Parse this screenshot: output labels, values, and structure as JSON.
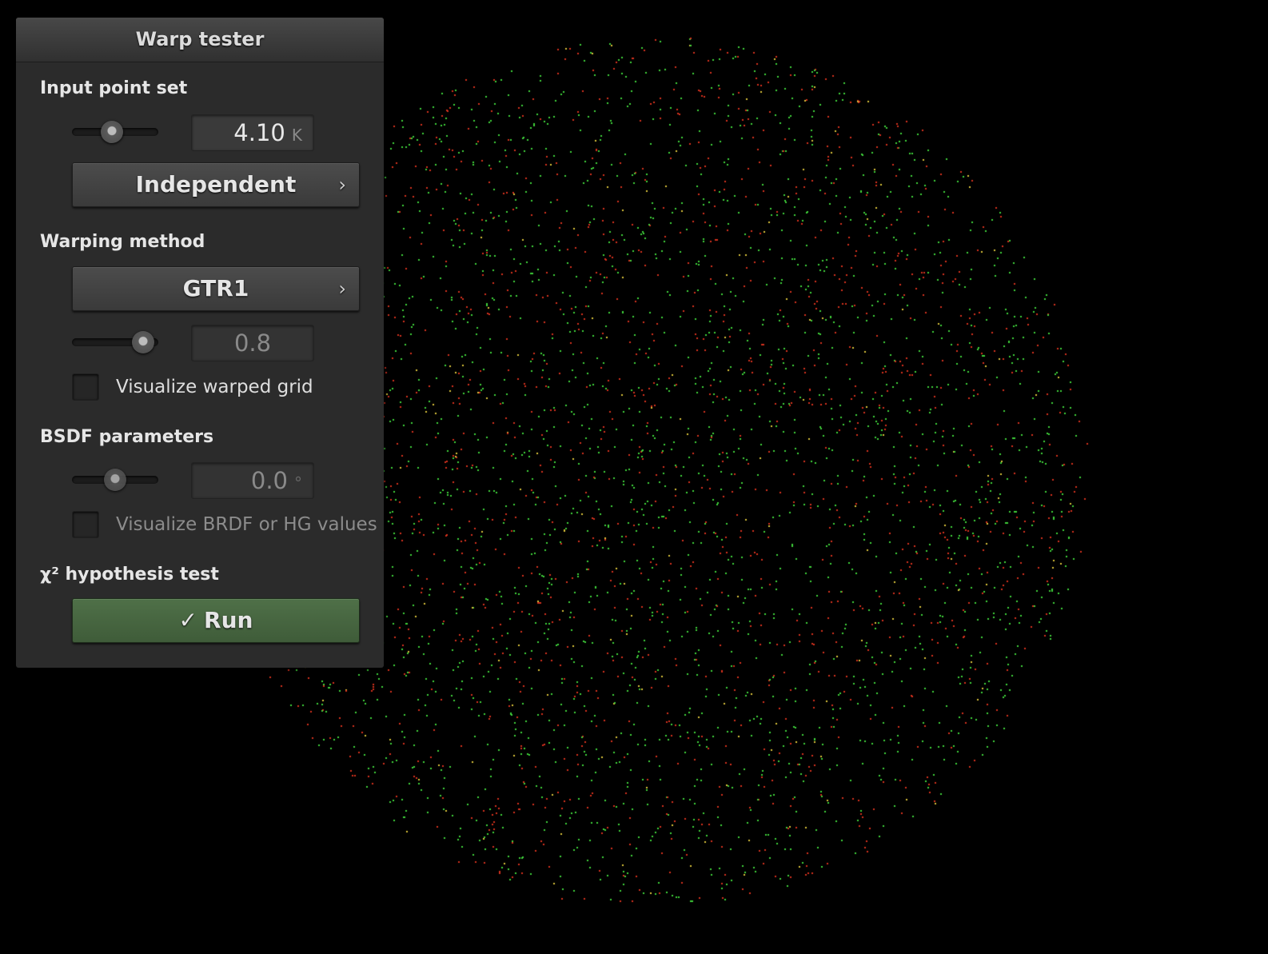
{
  "window": {
    "title": "Warp tester"
  },
  "input_point_set": {
    "section_label": "Input point set",
    "count_value": "4.10",
    "count_unit": "K",
    "count_slider_fraction": 0.46,
    "sampler_label": "Independent",
    "sampler_chevron": "›"
  },
  "warping_method": {
    "section_label": "Warping method",
    "method_label": "GTR1",
    "method_chevron": "›",
    "param_value": "0.8",
    "param_slider_fraction": 0.82,
    "grid_checkbox_label": "Visualize warped grid",
    "grid_checked": false
  },
  "bsdf_parameters": {
    "section_label": "BSDF parameters",
    "angle_value": "0.0",
    "angle_unit": "°",
    "angle_slider_fraction": 0.5,
    "brdf_checkbox_label": "Visualize BRDF or HG values",
    "brdf_checked": false
  },
  "hypothesis_test": {
    "section_label": "χ² hypothesis test",
    "run_icon": "check-icon",
    "run_check_glyph": "✓",
    "run_label": "Run"
  },
  "colors": {
    "background": "#000000",
    "panel": "#2b2b2b",
    "point_green": "#3fd13a",
    "point_red": "#d4301e",
    "point_yellow": "#d8c23a",
    "run_button": "#4a6a43"
  },
  "visualization": {
    "icon": "point-cloud-disk",
    "point_count": 4100
  }
}
